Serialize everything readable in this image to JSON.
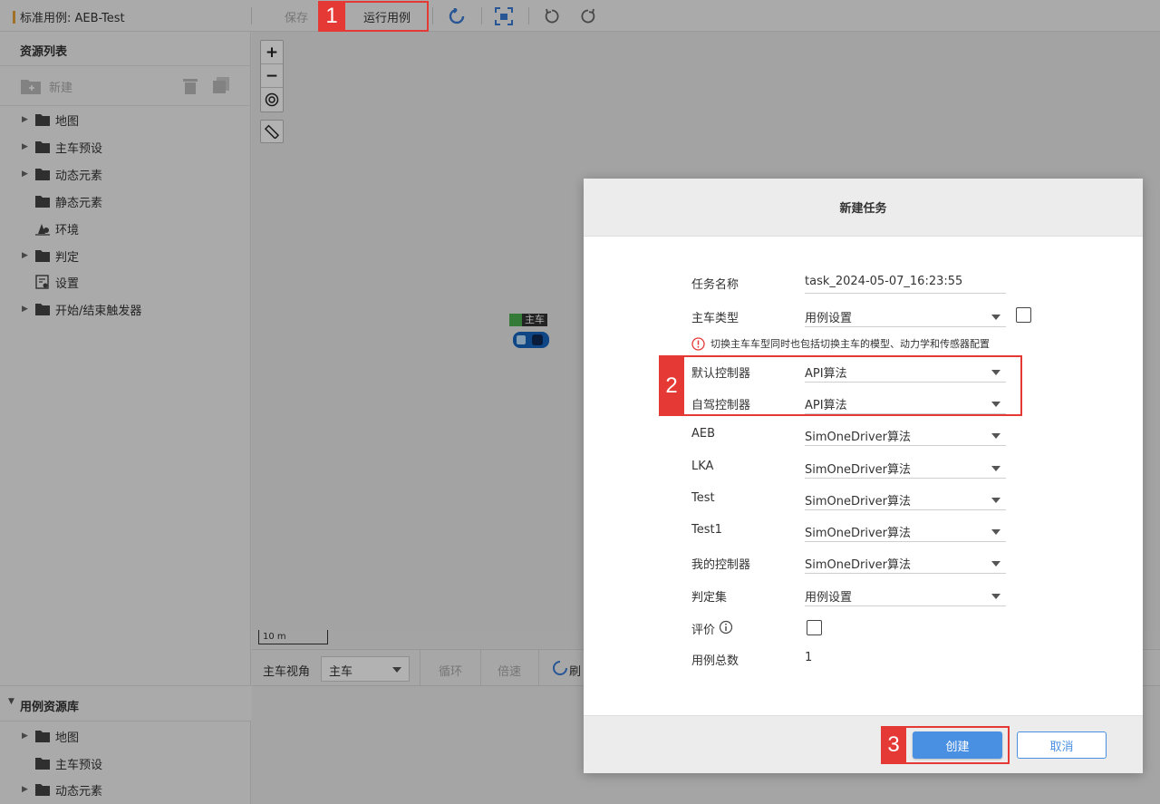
{
  "toolbar": {
    "case_title": "标准用例: AEB-Test",
    "save_label": "保存",
    "run_label": "运行用例"
  },
  "resource_panel": {
    "title": "资源列表",
    "new_label": "新建",
    "items": [
      {
        "label": "地图",
        "expandable": true,
        "icon": "folder-icon"
      },
      {
        "label": "主车预设",
        "expandable": true,
        "icon": "folder-icon"
      },
      {
        "label": "动态元素",
        "expandable": true,
        "icon": "folder-icon"
      },
      {
        "label": "静态元素",
        "expandable": false,
        "icon": "folder-icon"
      },
      {
        "label": "环境",
        "expandable": false,
        "icon": "environment-icon"
      },
      {
        "label": "判定",
        "expandable": true,
        "icon": "folder-icon"
      },
      {
        "label": "设置",
        "expandable": false,
        "icon": "settings-icon"
      },
      {
        "label": "开始/结束触发器",
        "expandable": true,
        "icon": "folder-icon"
      }
    ]
  },
  "library_panel": {
    "title": "用例资源库",
    "items": [
      {
        "label": "地图",
        "expandable": true
      },
      {
        "label": "主车预设",
        "expandable": false
      },
      {
        "label": "动态元素",
        "expandable": true
      }
    ]
  },
  "map": {
    "vehicle_label": "主车",
    "scale_label": "10 m"
  },
  "bottombar": {
    "view_label": "主车视角",
    "view_select": "主车",
    "loop_label": "循环",
    "speed_label": "倍速",
    "refresh_label": "刷"
  },
  "dialog": {
    "title": "新建任务",
    "task_name_label": "任务名称",
    "task_name_value": "task_2024-05-07_16:23:55",
    "vehicle_type_label": "主车类型",
    "vehicle_type_value": "用例设置",
    "hint": "切换主车车型同时也包括切换主车的模型、动力学和传感器配置",
    "controllers": [
      {
        "label": "默认控制器",
        "value": "API算法"
      },
      {
        "label": "自驾控制器",
        "value": "API算法"
      },
      {
        "label": "AEB",
        "value": "SimOneDriver算法"
      },
      {
        "label": "LKA",
        "value": "SimOneDriver算法"
      },
      {
        "label": "Test",
        "value": "SimOneDriver算法"
      },
      {
        "label": "Test1",
        "value": "SimOneDriver算法"
      },
      {
        "label": "我的控制器",
        "value": "SimOneDriver算法"
      }
    ],
    "judge_label": "判定集",
    "judge_value": "用例设置",
    "eval_label": "评价",
    "total_label": "用例总数",
    "total_value": "1",
    "create_label": "创建",
    "cancel_label": "取消"
  },
  "annotations": {
    "step1": "1",
    "step2": "2",
    "step3": "3"
  },
  "colors": {
    "primary": "#4a90e2",
    "annotation": "#e53935",
    "accent_bar": "#e8a23a"
  }
}
